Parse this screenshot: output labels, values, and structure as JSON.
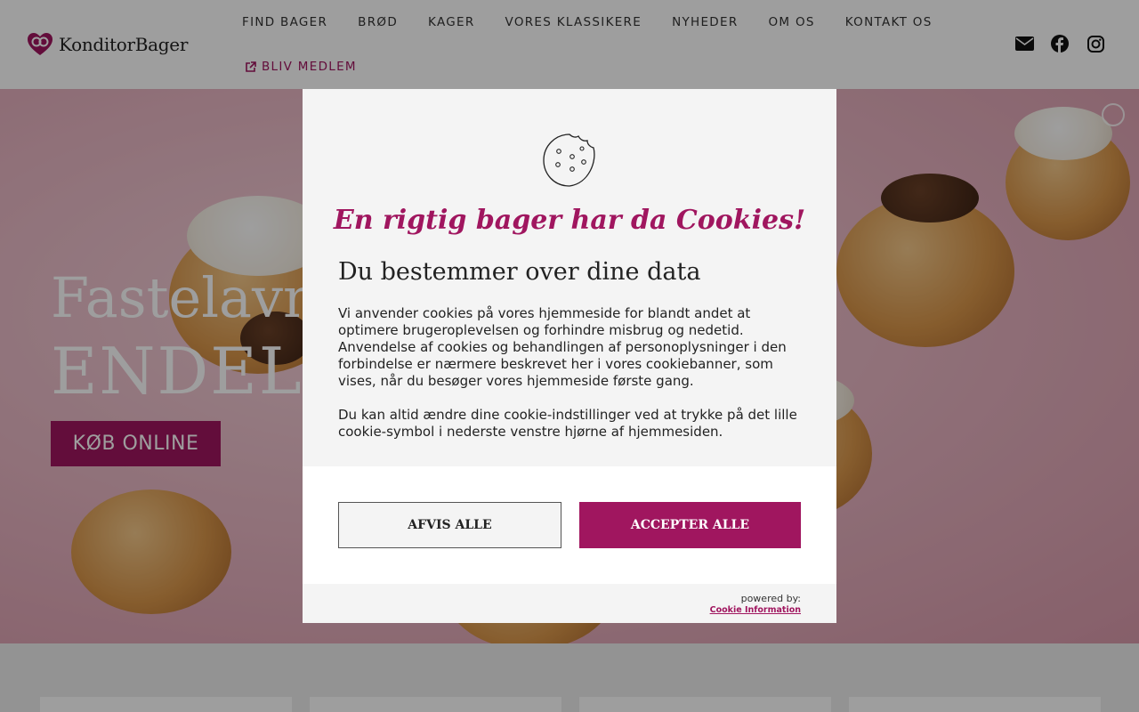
{
  "brand": {
    "name": "KonditorBager",
    "accent": "#a0165f"
  },
  "nav": {
    "items": [
      {
        "label": "FIND BAGER"
      },
      {
        "label": "BRØD"
      },
      {
        "label": "KAGER"
      },
      {
        "label": "VORES KLASSIKERE"
      },
      {
        "label": "NYHEDER"
      },
      {
        "label": "OM OS"
      },
      {
        "label": "KONTAKT OS"
      }
    ],
    "member_label": "BLIV MEDLEM"
  },
  "social": [
    "envelope-icon",
    "facebook-icon",
    "instagram-icon"
  ],
  "hero": {
    "title_line1": "Fastelavns",
    "title_line2": "ENDELI",
    "button_label": "KØB ONLINE"
  },
  "cookie_modal": {
    "headline": "En rigtig bager har da Cookies!",
    "title": "Du bestemmer over dine data",
    "paragraph1": "Vi anvender cookies på vores hjemmeside for blandt andet at optimere brugeroplevelsen og forhindre misbrug og nedetid. Anvendelse af cookies og behandlingen af personoplysninger i den forbindelse er nærmere beskrevet her i vores cookiebanner, som vises, når du besøger vores hjemmeside første gang.",
    "paragraph2": "Du kan altid ændre dine cookie-indstillinger ved at trykke på det lille cookie-symbol i nederste venstre hjørne af hjemmesiden.",
    "decline_label": "AFVIS ALLE",
    "accept_label": "ACCEPTER ALLE",
    "powered_by": "powered by:",
    "provider_link": "Cookie Information"
  }
}
